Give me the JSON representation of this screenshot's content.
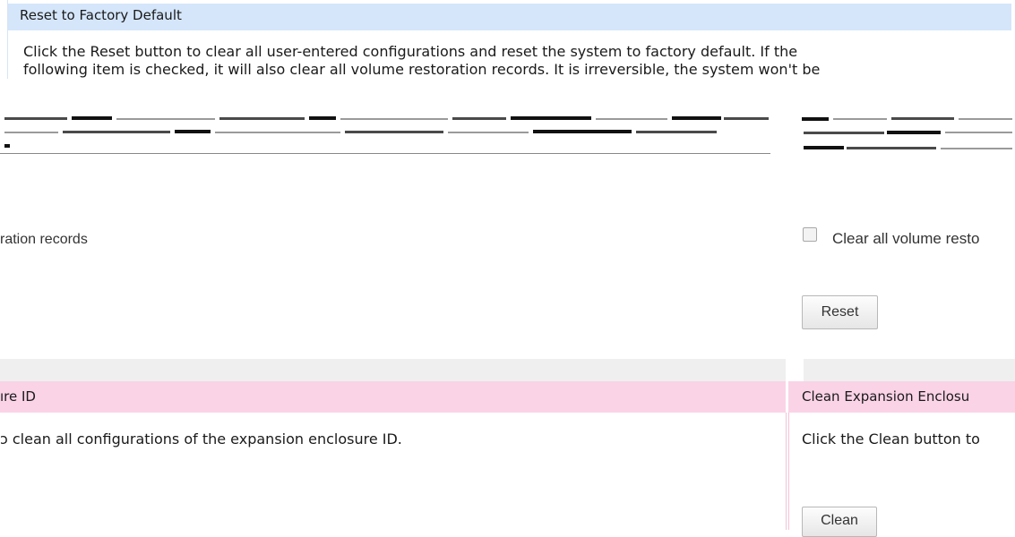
{
  "reset_panel": {
    "title": "Reset to Factory Default",
    "description_line1": "Click the Reset button to clear all user-entered configurations and reset the system to factory default. If the",
    "description_line2": "following item is checked, it will also clear all volume restoration records. It is irreversible, the system won't be"
  },
  "restore_records": {
    "left_label": "ration records",
    "checkbox_label": "Clear all volume resto",
    "checkbox_checked": false,
    "reset_button": "Reset"
  },
  "clean_enclosure": {
    "left_title": "ıre ID",
    "right_title": "Clean Expansion Enclosu",
    "left_description": "ɔ clean all configurations of the expansion enclosure ID.",
    "right_description": "Click the Clean button to",
    "clean_button": "Clean"
  },
  "colors": {
    "blue_header": "#d5e6fb",
    "pink_header": "#fad3e6",
    "gray_band": "#efefef"
  }
}
